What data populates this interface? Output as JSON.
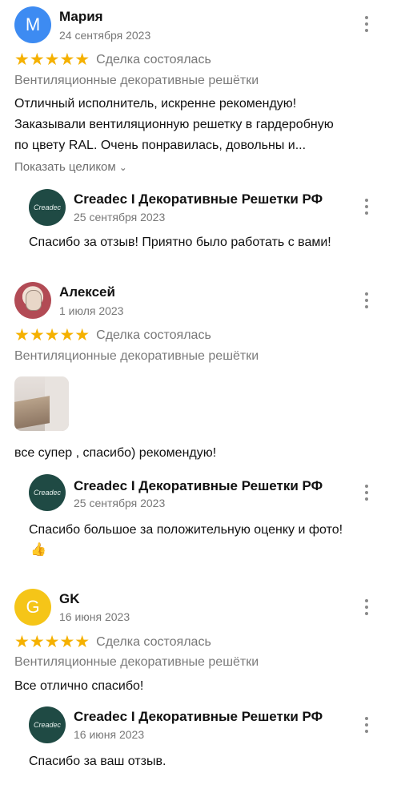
{
  "reviews": [
    {
      "avatar_letter": "M",
      "avatar_color": "#3d8bf2",
      "name": "Мария",
      "date": "24 сентября 2023",
      "stars": "★★★★★",
      "deal_status": "Сделка состоялась",
      "category": "Вентиляционные декоративные решётки",
      "text_lines": [
        "Отличный исполнитель, искренне рекомендую!",
        "Заказывали вентиляционную решетку в гардеробную",
        "по цвету RAL. Очень понравилась, довольны и..."
      ],
      "show_all": "Показать целиком",
      "reply": {
        "avatar_text": "Creadec",
        "name": "Creadec I Декоративные Решетки РФ",
        "date": "25 сентября 2023",
        "text": "Спасибо за отзыв! Приятно было работать с вами!"
      }
    },
    {
      "name": "Алексей",
      "date": "1 июля 2023",
      "stars": "★★★★★",
      "deal_status": "Сделка состоялась",
      "category": "Вентиляционные декоративные решётки",
      "text": "все супер , спасибо) рекомендую!",
      "reply": {
        "avatar_text": "Creadec",
        "name": "Creadec I Декоративные Решетки РФ",
        "date": "25 сентября 2023",
        "text": "Спасибо большое за положительную оценку и фото!",
        "emoji": "👍"
      }
    },
    {
      "avatar_letter": "G",
      "avatar_color": "#f5c518",
      "name": "GK",
      "date": "16 июня 2023",
      "stars": "★★★★★",
      "deal_status": "Сделка состоялась",
      "category": "Вентиляционные декоративные решётки",
      "text": "Все отлично спасибо!",
      "reply": {
        "avatar_text": "Creadec",
        "name": "Creadec I Декоративные Решетки РФ",
        "date": "16 июня 2023",
        "text": "Спасибо за ваш отзыв."
      }
    }
  ],
  "colors": {
    "star": "#f5b100",
    "brand_avatar": "#1f4a44"
  },
  "icons": {
    "more": "more-vertical-icon",
    "chevron": "chevron-down-icon"
  }
}
